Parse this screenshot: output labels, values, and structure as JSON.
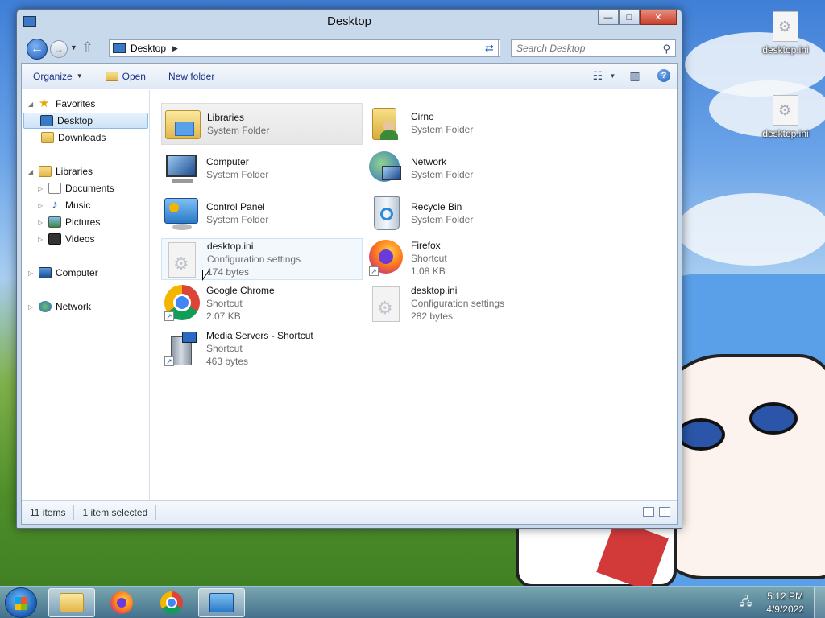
{
  "window": {
    "title": "Desktop",
    "controls": {
      "minimize": "—",
      "maximize": "□",
      "close": "✕"
    }
  },
  "navbar": {
    "address_path": "Desktop",
    "search_placeholder": "Search Desktop"
  },
  "commandbar": {
    "organize": "Organize",
    "open": "Open",
    "new_folder": "New folder"
  },
  "navpane": {
    "favorites": "Favorites",
    "desktop": "Desktop",
    "downloads": "Downloads",
    "libraries": "Libraries",
    "documents": "Documents",
    "music": "Music",
    "pictures": "Pictures",
    "videos": "Videos",
    "computer": "Computer",
    "network": "Network"
  },
  "files": [
    {
      "name": "Libraries",
      "type": "System Folder",
      "size": ""
    },
    {
      "name": "Cirno",
      "type": "System Folder",
      "size": ""
    },
    {
      "name": "Computer",
      "type": "System Folder",
      "size": ""
    },
    {
      "name": "Network",
      "type": "System Folder",
      "size": ""
    },
    {
      "name": "Control Panel",
      "type": "System Folder",
      "size": ""
    },
    {
      "name": "Recycle Bin",
      "type": "System Folder",
      "size": ""
    },
    {
      "name": "desktop.ini",
      "type": "Configuration settings",
      "size": "174 bytes"
    },
    {
      "name": "Firefox",
      "type": "Shortcut",
      "size": "1.08 KB"
    },
    {
      "name": "Google Chrome",
      "type": "Shortcut",
      "size": "2.07 KB"
    },
    {
      "name": "desktop.ini",
      "type": "Configuration settings",
      "size": "282 bytes"
    },
    {
      "name": "Media Servers - Shortcut",
      "type": "Shortcut",
      "size": "463 bytes"
    }
  ],
  "status": {
    "items": "11 items",
    "selected": "1 item selected"
  },
  "desktop_icons": [
    "desktop.ini",
    "desktop.ini"
  ],
  "taskbar": {
    "time": "5:12 PM",
    "date": "4/9/2022"
  },
  "colors": {
    "link_blue": "#1e3287",
    "selection_blue": "#cde3f8",
    "close_red": "#c7402b"
  }
}
